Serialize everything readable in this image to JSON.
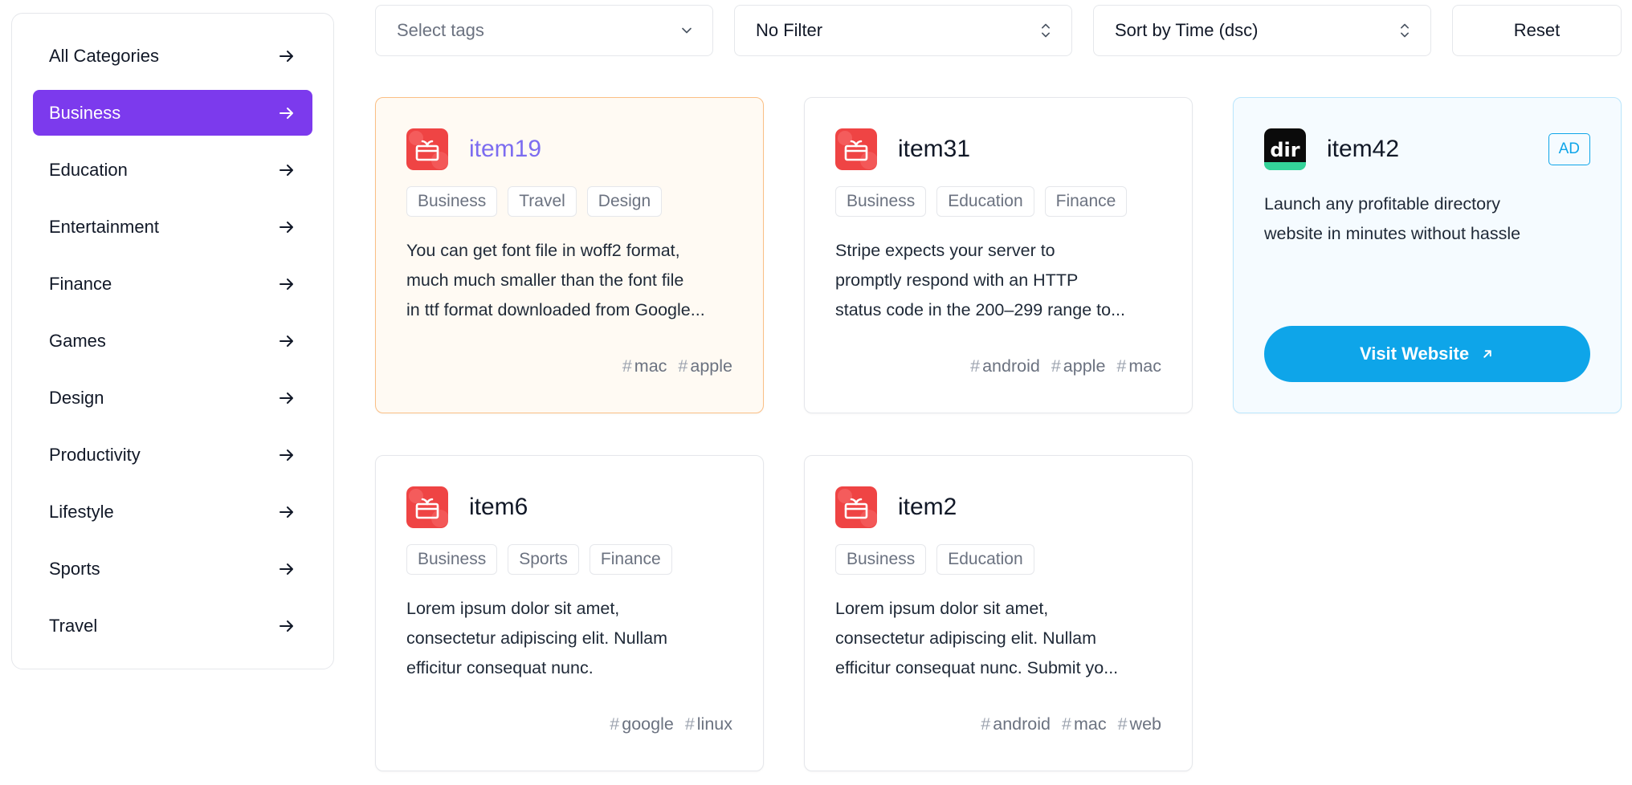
{
  "sidebar": {
    "items": [
      {
        "label": "All Categories"
      },
      {
        "label": "Business"
      },
      {
        "label": "Education"
      },
      {
        "label": "Entertainment"
      },
      {
        "label": "Finance"
      },
      {
        "label": "Games"
      },
      {
        "label": "Design"
      },
      {
        "label": "Productivity"
      },
      {
        "label": "Lifestyle"
      },
      {
        "label": "Sports"
      },
      {
        "label": "Travel"
      }
    ],
    "active_item": "Business"
  },
  "filters": {
    "tags_placeholder": "Select tags",
    "filter_value": "No Filter",
    "sort_value": "Sort by Time (dsc)",
    "reset_label": "Reset"
  },
  "cards": [
    {
      "title": "item19",
      "icon": "gift-app-icon",
      "tags": [
        "Business",
        "Travel",
        "Design"
      ],
      "desc_lines": [
        "You can get font file in woff2 format,",
        "much much smaller than the font file",
        "in ttf format downloaded from Google..."
      ],
      "hashtags": [
        "mac",
        "apple"
      ]
    },
    {
      "title": "item31",
      "icon": "gift-app-icon",
      "tags": [
        "Business",
        "Education",
        "Finance"
      ],
      "desc_lines": [
        "Stripe expects your server to",
        "promptly respond with an HTTP",
        "status code in the 200–299 range to..."
      ],
      "hashtags": [
        "android",
        "apple",
        "mac"
      ]
    },
    {
      "title": "item6",
      "icon": "gift-app-icon",
      "tags": [
        "Business",
        "Sports",
        "Finance"
      ],
      "desc_lines": [
        "Lorem ipsum dolor sit amet,",
        "consectetur adipiscing elit. Nullam",
        "efficitur consequat nunc."
      ],
      "hashtags": [
        "google",
        "linux"
      ]
    },
    {
      "title": "item2",
      "icon": "gift-app-icon",
      "tags": [
        "Business",
        "Education"
      ],
      "desc_lines": [
        "Lorem ipsum dolor sit amet,",
        "consectetur adipiscing elit. Nullam",
        "efficitur consequat nunc. Submit yo..."
      ],
      "hashtags": [
        "android",
        "mac",
        "web"
      ]
    }
  ],
  "ad_card": {
    "title": "item42",
    "logo_text": "dir",
    "badge": "AD",
    "desc_lines": [
      "Launch any profitable directory",
      "website in minutes without hassle"
    ],
    "button_label": "Visit Website"
  },
  "colors": {
    "accent": "#7c3aed",
    "ad_blue": "#0ea5e9",
    "icon_red": "#ef4444"
  }
}
